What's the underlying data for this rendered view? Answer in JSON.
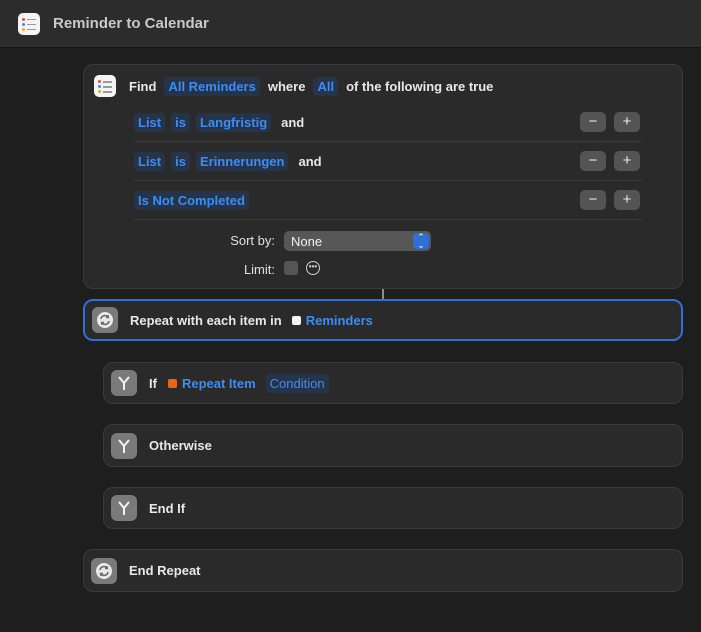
{
  "window": {
    "title": "Reminder to Calendar"
  },
  "find": {
    "label": "Find",
    "scope": "All Reminders",
    "where": "where",
    "quantifier": "All",
    "suffix": "of the following are true",
    "conditions": [
      {
        "field": "List",
        "op": "is",
        "value": "Langfristig",
        "joiner": "and"
      },
      {
        "field": "List",
        "op": "is",
        "value": "Erinnerungen",
        "joiner": "and"
      },
      {
        "field": "Is Not Completed",
        "op": "",
        "value": "",
        "joiner": ""
      }
    ],
    "minus_label": "−",
    "plus_label": "+",
    "sort_label": "Sort by:",
    "sort_value": "None",
    "limit_label": "Limit:"
  },
  "repeat": {
    "label": "Repeat with each item in",
    "variable": "Reminders"
  },
  "if_block": {
    "label": "If",
    "variable": "Repeat Item",
    "condition": "Condition"
  },
  "otherwise": {
    "label": "Otherwise"
  },
  "end_if": {
    "label": "End If"
  },
  "end_repeat": {
    "label": "End Repeat"
  },
  "colors": {
    "accent": "#2f6fd6",
    "token": "#3d8cf5",
    "background": "#1e1e1e",
    "card": "#2a2a2a",
    "repeat_item_icon": "#e8631c"
  },
  "icons": {
    "app": "reminders-list-icon",
    "repeat": "repeat-arrows-icon",
    "branch": "branch-fork-icon"
  }
}
